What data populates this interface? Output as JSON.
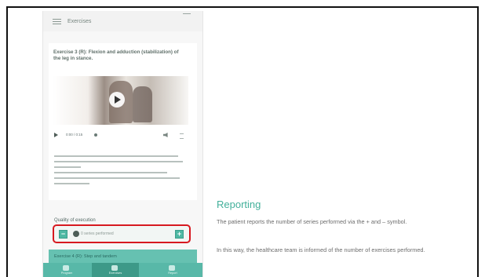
{
  "slide": {
    "heading": "Reporting",
    "paragraphs": [
      "The patient reports the number of series performed via the + and – symbol.",
      "In this way, the healthcare team is informed of the number of exercises performed."
    ]
  },
  "phone": {
    "appbar_title": "Exercises",
    "exercise_title": "Exercise 3 (R): Flexion and adduction (stabilization) of the leg in stance.",
    "media_time": "0:00 / 0:15",
    "quality_label": "Quality of execution",
    "series_text": "0 series performed",
    "minus_symbol": "−",
    "plus_symbol": "+",
    "next_exercise_title": "Exercise 4 (R): Step and tandem",
    "nav_labels": [
      "Program",
      "Exercises",
      "Report"
    ]
  },
  "colors": {
    "accent": "#43b09b",
    "highlight": "#d71920",
    "nav": "#58b8a8"
  },
  "icons": [
    "menu-icon",
    "play-icon",
    "volume-icon",
    "more-icon",
    "check-icon",
    "minus-icon",
    "plus-icon"
  ]
}
